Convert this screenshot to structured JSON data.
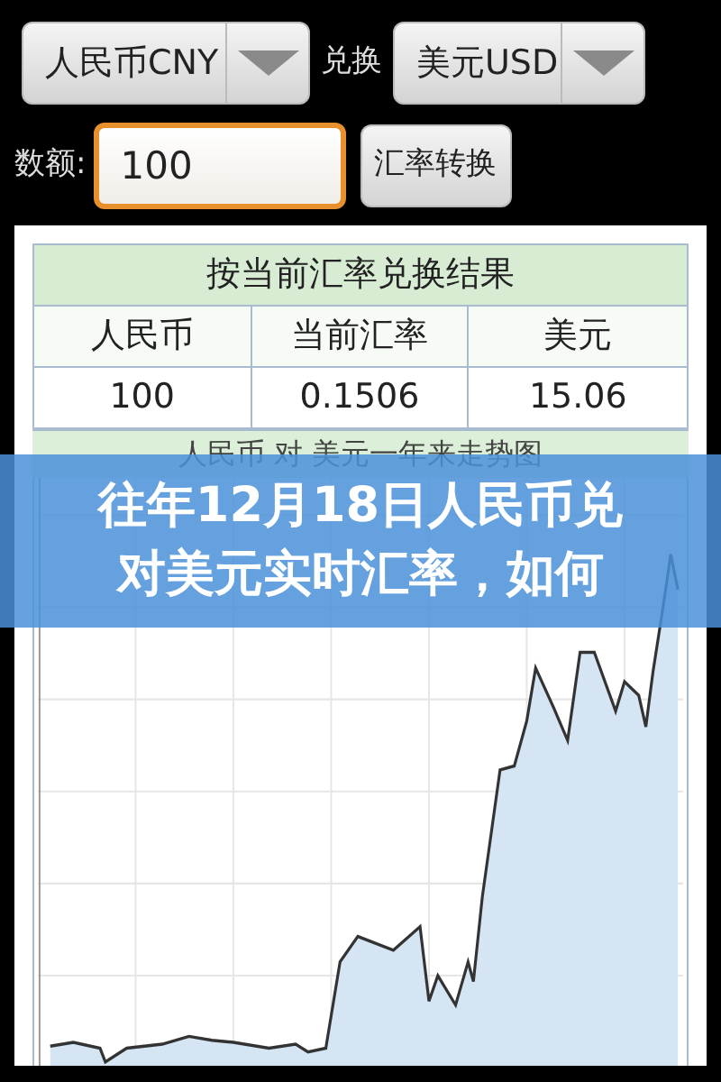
{
  "from_currency": {
    "value": "人民币CNY"
  },
  "convert_label": "兑换",
  "to_currency": {
    "value": "美元USD"
  },
  "amount": {
    "label": "数额:",
    "value": "100",
    "focused": true
  },
  "convert_button": "汇率转换",
  "result_table": {
    "title": "按当前汇率兑换结果",
    "columns": [
      "人民币",
      "当前汇率",
      "美元"
    ],
    "rows": [
      [
        "100",
        "0.1506",
        "15.06"
      ]
    ]
  },
  "chart": {
    "title": "人民币 对 美元一年来走势图"
  },
  "overlay_caption": [
    "往年12月18日人民币兑",
    "对美元实时汇率，如何"
  ]
}
